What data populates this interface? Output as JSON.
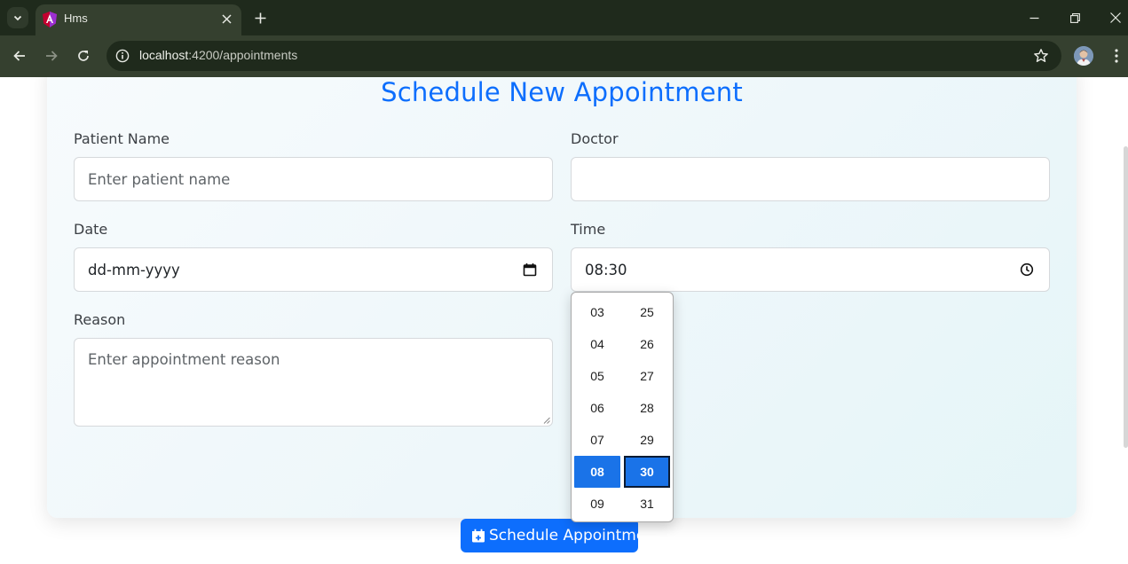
{
  "browser": {
    "tab_title": "Hms",
    "url_host": "localhost",
    "url_rest": ":4200/appointments"
  },
  "form": {
    "title": "Schedule New Appointment",
    "patient_label": "Patient Name",
    "patient_placeholder": "Enter patient name",
    "doctor_label": "Doctor",
    "doctor_value": "",
    "date_label": "Date",
    "date_value": "dd-mm-yyyy",
    "time_label": "Time",
    "time_value": "08:30",
    "reason_label": "Reason",
    "reason_placeholder": "Enter appointment reason",
    "submit_label": "Schedule Appointment"
  },
  "time_picker": {
    "hours": [
      "03",
      "04",
      "05",
      "06",
      "07",
      "08",
      "09"
    ],
    "minutes": [
      "25",
      "26",
      "27",
      "28",
      "29",
      "30",
      "31"
    ],
    "selected_hour": "08",
    "selected_minute": "30"
  },
  "colors": {
    "accent": "#0d6efd",
    "chrome_dark": "#1f2a1c",
    "chrome_toolbar": "#35402f"
  },
  "icons": {
    "tab_search": "chevron-down-icon",
    "favicon": "angular-logo-icon",
    "close": "close-icon",
    "new_tab": "plus-icon",
    "back": "arrow-left-icon",
    "forward": "arrow-right-icon",
    "reload": "reload-icon",
    "site_info": "info-icon",
    "bookmark": "star-icon",
    "menu": "kebab-menu-icon",
    "calendar": "calendar-icon",
    "clock": "clock-icon",
    "calendar_plus": "calendar-plus-icon"
  }
}
